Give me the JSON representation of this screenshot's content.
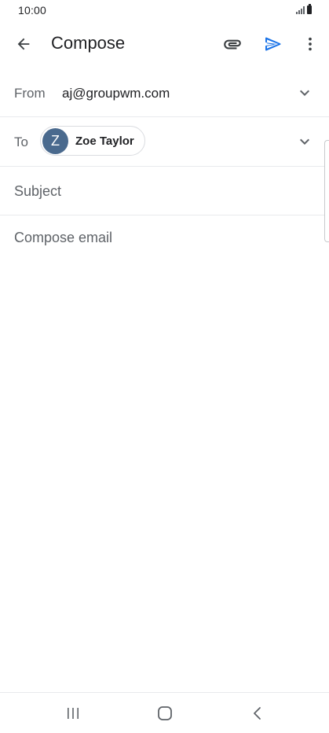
{
  "status_bar": {
    "time": "10:00",
    "icons": [
      "signal-icon",
      "battery-icon"
    ]
  },
  "app_bar": {
    "title": "Compose",
    "icons": [
      "back-arrow-icon",
      "paperclip-icon",
      "send-icon",
      "more-vert-icon"
    ]
  },
  "from": {
    "label": "From",
    "value": "aj@groupwm.com"
  },
  "to": {
    "label": "To",
    "recipients": [
      {
        "initial": "Z",
        "name": "Zoe Taylor"
      }
    ]
  },
  "subject": {
    "placeholder": "Subject",
    "value": ""
  },
  "body": {
    "placeholder": "Compose email",
    "value": ""
  },
  "nav_bar": {
    "icons": [
      "recents-icon",
      "home-icon",
      "back-icon"
    ]
  },
  "colors": {
    "accent": "#1a73e8",
    "avatar": "#4a6a8e",
    "text_primary": "#202124",
    "text_secondary": "#5f6368",
    "divider": "#e8eaed"
  }
}
